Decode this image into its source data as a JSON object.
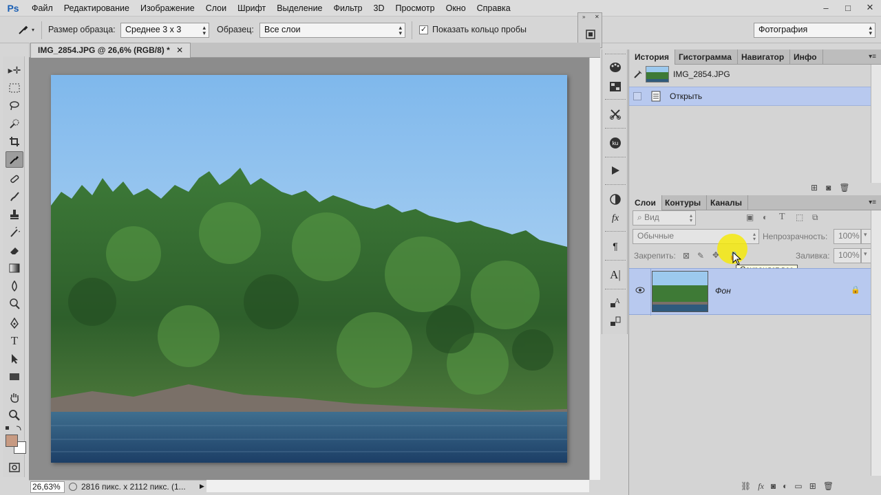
{
  "app": {
    "logo": "Ps",
    "menu": [
      "Файл",
      "Редактирование",
      "Изображение",
      "Слои",
      "Шрифт",
      "Выделение",
      "Фильтр",
      "3D",
      "Просмотр",
      "Окно",
      "Справка"
    ],
    "window_controls": {
      "minimize": "–",
      "maximize": "□",
      "close": "✕"
    }
  },
  "options": {
    "sample_size_label": "Размер образца:",
    "sample_size_value": "Среднее 3 х 3",
    "sample_label": "Образец:",
    "sample_value": "Все слои",
    "show_ring_label": "Показать кольцо пробы",
    "show_ring_checked": true,
    "workspace_value": "Фотография"
  },
  "document": {
    "tab_title": "IMG_2854.JPG @ 26,6% (RGB/8) *",
    "zoom": "26,63%",
    "info": "2816 пикс. x 2112 пикс. (1..."
  },
  "history_panel": {
    "tabs": [
      "История",
      "Гистограмма",
      "Навигатор",
      "Инфо"
    ],
    "active_tab": 0,
    "snapshot_name": "IMG_2854.JPG",
    "steps": [
      "Открыть"
    ]
  },
  "layers_panel": {
    "tabs": [
      "Слои",
      "Контуры",
      "Каналы"
    ],
    "active_tab": 0,
    "filter_kind": "Вид",
    "blend_mode": "Обычные",
    "opacity_label": "Непрозрачность:",
    "opacity_value": "100%",
    "lock_label": "Закрепить:",
    "fill_label": "Заливка:",
    "fill_value": "100%",
    "tooltip": "Сохраняет все",
    "layers": [
      {
        "name": "Фон",
        "visible": true,
        "locked": true
      }
    ]
  },
  "colors": {
    "foreground": "#c79a82",
    "background": "#ffffff",
    "selection": "#b8c9ef"
  }
}
